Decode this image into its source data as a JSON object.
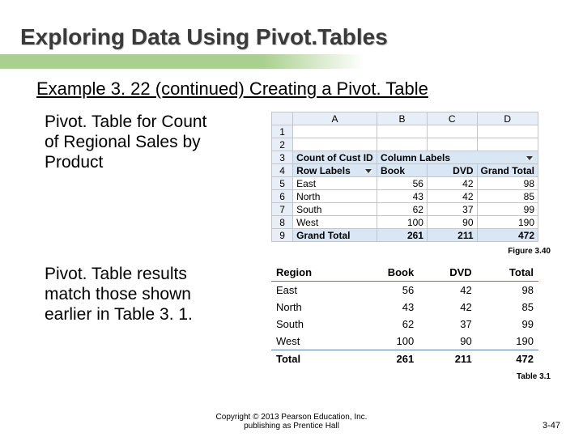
{
  "title": "Exploring Data Using Pivot.Tables",
  "subtitle": "Example 3. 22 (continued)  Creating a Pivot. Table",
  "para1_l1": "Pivot. Table for Count",
  "para1_l2": "of Regional Sales by",
  "para1_l3": "Product",
  "para2_l1": "Pivot. Table results",
  "para2_l2": "match those shown",
  "para2_l3": "earlier in Table 3. 1.",
  "fig1_label": "Figure 3.40",
  "fig2_label": "Table 3.1",
  "excel_cols": {
    "A": "A",
    "B": "B",
    "C": "C",
    "D": "D"
  },
  "pivot": {
    "count_label": "Count of Cust ID",
    "collab_label": "Column Labels",
    "rowlab_label": "Row Labels",
    "c_book": "Book",
    "c_dvd": "DVD",
    "c_gt": "Grand Total",
    "rows": [
      {
        "r": "East",
        "b": "56",
        "d": "42",
        "t": "98"
      },
      {
        "r": "North",
        "b": "43",
        "d": "42",
        "t": "85"
      },
      {
        "r": "South",
        "b": "62",
        "d": "37",
        "t": "99"
      },
      {
        "r": "West",
        "b": "100",
        "d": "90",
        "t": "190"
      }
    ],
    "gt_label": "Grand Total",
    "gt_b": "261",
    "gt_d": "211",
    "gt_t": "472"
  },
  "plain": {
    "h_region": "Region",
    "h_book": "Book",
    "h_dvd": "DVD",
    "h_total": "Total",
    "rows": [
      {
        "r": "East",
        "b": "56",
        "d": "42",
        "t": "98"
      },
      {
        "r": "North",
        "b": "43",
        "d": "42",
        "t": "85"
      },
      {
        "r": "South",
        "b": "62",
        "d": "37",
        "t": "99"
      },
      {
        "r": "West",
        "b": "100",
        "d": "90",
        "t": "190"
      }
    ],
    "tot_label": "Total",
    "tot_b": "261",
    "tot_d": "211",
    "tot_t": "472"
  },
  "copyright_l1": "Copyright © 2013 Pearson Education, Inc.",
  "copyright_l2": "publishing as Prentice Hall",
  "pagenum": "3-47",
  "chart_data": {
    "type": "table",
    "title": "Count of Regional Sales by Product",
    "categories": [
      "East",
      "North",
      "South",
      "West"
    ],
    "series": [
      {
        "name": "Book",
        "values": [
          56,
          43,
          62,
          100
        ]
      },
      {
        "name": "DVD",
        "values": [
          42,
          42,
          37,
          90
        ]
      }
    ],
    "totals": {
      "Book": 261,
      "DVD": 211,
      "Grand": 472
    }
  }
}
